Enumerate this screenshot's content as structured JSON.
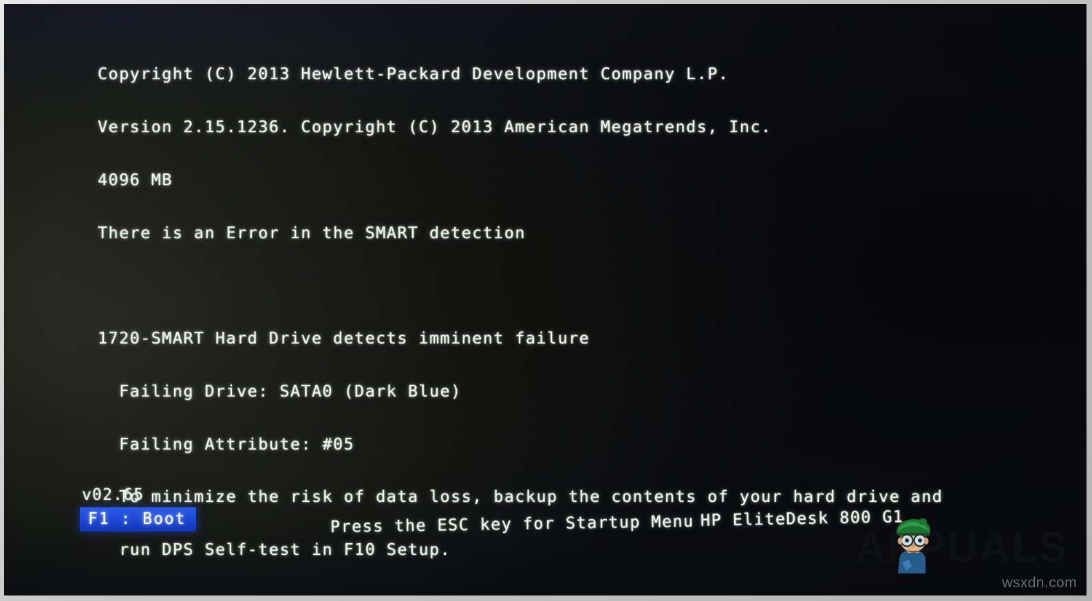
{
  "screen": {
    "type": "bios-post-error",
    "background_color": "#12141c",
    "text_color": "#f2f4ef",
    "accent_color": "#1c46d4"
  },
  "bios": {
    "lines": [
      "Copyright (C) 2013 Hewlett-Packard Development Company L.P.",
      "Version 2.15.1236. Copyright (C) 2013 American Megatrends, Inc.",
      "4096 MB",
      "There is an Error in the SMART detection"
    ],
    "error": {
      "code_line": "1720-SMART Hard Drive detects imminent failure",
      "failing_drive": "  Failing Drive: SATA0 (Dark Blue)",
      "failing_attribute": "  Failing Attribute: #05",
      "advice_line1": "  To minimize the risk of data loss, backup the contents of your hard drive and",
      "advice_line2": "  run DPS Self-test in F10 Setup."
    }
  },
  "footer": {
    "version": "v02.65",
    "f1_boot_label": "F1 : Boot",
    "esc_hint": "Press the ESC key for Startup Menu",
    "model": "HP EliteDesk 800 G1"
  },
  "watermarks": {
    "brand": "APPUALS",
    "corner": "wsxdn.com"
  },
  "icons": {
    "mascot": "appuals-mascot-icon"
  }
}
